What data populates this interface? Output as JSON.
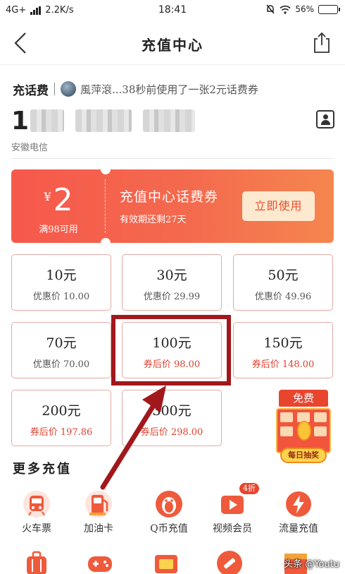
{
  "status_bar": {
    "network": "4G+",
    "speed": "2.2K/s",
    "time": "18:41",
    "battery": "56%",
    "battery_level": 0.56
  },
  "nav": {
    "title": "充值中心",
    "back_icon": "chevron-left-icon",
    "share_icon": "share-icon"
  },
  "recharge": {
    "label": "充话费",
    "feed": "風萍滾...38秒前使用了一张2元话费券",
    "phone_first_digit": "1",
    "carrier": "安徽电信",
    "contact_icon": "contact-book-icon"
  },
  "coupon": {
    "currency": "¥",
    "amount": "2",
    "condition": "满98可用",
    "title": "充值中心话费券",
    "validity": "有效期还剩27天",
    "button": "立即使用",
    "gradient_start": "#f6584c",
    "gradient_end": "#f5864f"
  },
  "options": [
    {
      "value": "10元",
      "price": "优惠价 10.00",
      "after_coupon": false
    },
    {
      "value": "30元",
      "price": "优惠价 29.99",
      "after_coupon": false
    },
    {
      "value": "50元",
      "price": "优惠价 49.96",
      "after_coupon": false
    },
    {
      "value": "70元",
      "price": "优惠价 70.00",
      "after_coupon": false
    },
    {
      "value": "100元",
      "price": "券后价 98.00",
      "after_coupon": true
    },
    {
      "value": "150元",
      "price": "券后价 148.00",
      "after_coupon": true
    },
    {
      "value": "200元",
      "price": "券后价 197.86",
      "after_coupon": true
    },
    {
      "value": "300元",
      "price": "券后价 298.00",
      "after_coupon": true
    }
  ],
  "lucky_draw": {
    "ribbon": "免费",
    "tag": "每日抽奖"
  },
  "more": {
    "title": "更多充值",
    "services": [
      {
        "label": "火车票",
        "icon": "train-icon"
      },
      {
        "label": "加油卡",
        "icon": "gas-pump-icon"
      },
      {
        "label": "Q币充值",
        "icon": "qq-penguin-icon"
      },
      {
        "label": "视频会员",
        "icon": "video-play-icon",
        "badge": "4折"
      },
      {
        "label": "流量充值",
        "icon": "lightning-icon"
      }
    ],
    "second_row_icons": [
      "suitcase-icon",
      "gamepad-icon",
      "tv-icon",
      "pen-icon",
      "card-icon"
    ]
  },
  "colors": {
    "accent_red": "#e8452f",
    "price_red": "#e0402f",
    "highlight_box": "#a1181c"
  },
  "watermark": "头条 @Youtu"
}
